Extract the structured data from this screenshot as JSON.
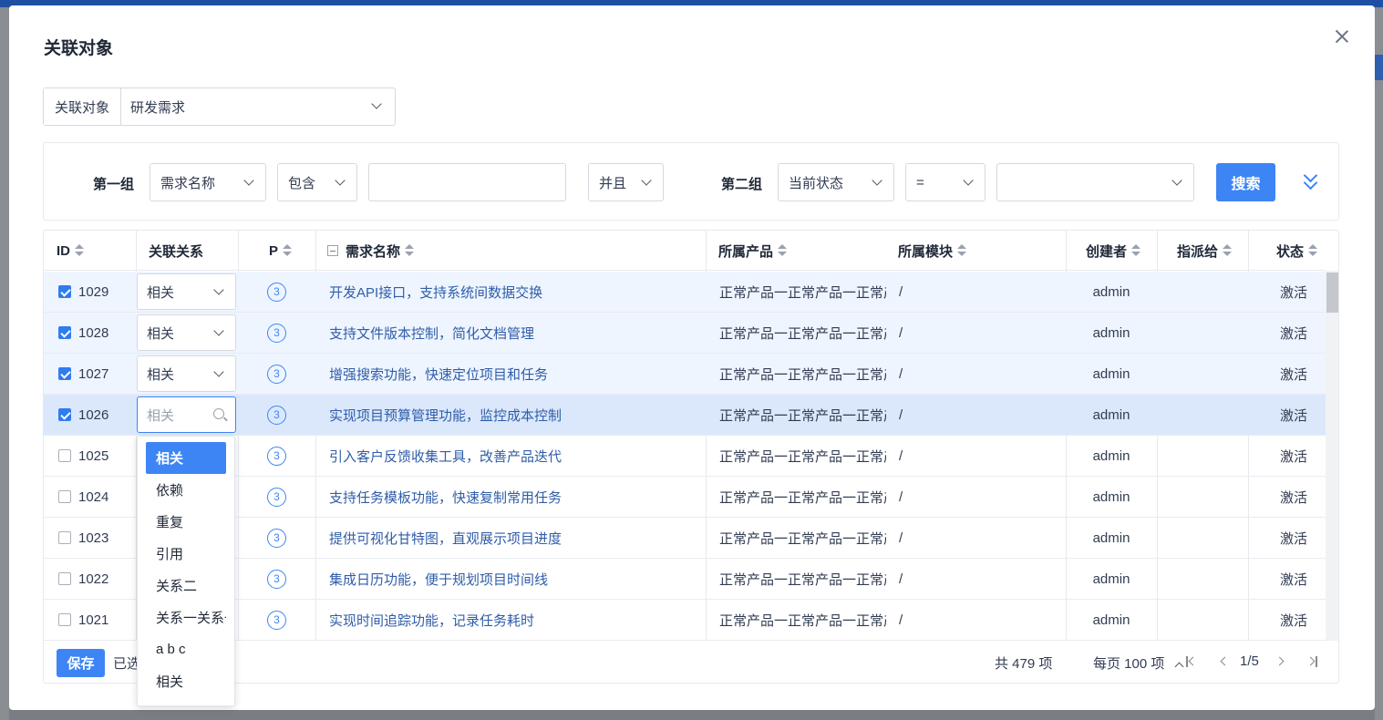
{
  "modal": {
    "title": "关联对象",
    "object_type_label": "关联对象",
    "object_type_value": "研发需求"
  },
  "search": {
    "group1_label": "第一组",
    "group1_field": "需求名称",
    "group1_operator": "包含",
    "group1_value": "",
    "logic": "并且",
    "group2_label": "第二组",
    "group2_field": "当前状态",
    "group2_operator": "=",
    "group2_value": "",
    "search_button": "搜索"
  },
  "table": {
    "headers": {
      "id": "ID",
      "relation": "关联关系",
      "priority": "P",
      "name": "需求名称",
      "product": "所属产品",
      "module": "所属模块",
      "creator": "创建者",
      "assignee": "指派给",
      "status": "状态"
    },
    "rows": [
      {
        "id": "1029",
        "checked": true,
        "relation": "相关",
        "priority": "3",
        "name": "开发API接口，支持系统间数据交换",
        "product": "正常产品一正常产品一正常产品",
        "module": "/",
        "creator": "admin",
        "assignee": "",
        "status": "激活"
      },
      {
        "id": "1028",
        "checked": true,
        "relation": "相关",
        "priority": "3",
        "name": "支持文件版本控制，简化文档管理",
        "product": "正常产品一正常产品一正常产品",
        "module": "/",
        "creator": "admin",
        "assignee": "",
        "status": "激活"
      },
      {
        "id": "1027",
        "checked": true,
        "relation": "相关",
        "priority": "3",
        "name": "增强搜索功能，快速定位项目和任务",
        "product": "正常产品一正常产品一正常产品",
        "module": "/",
        "creator": "admin",
        "assignee": "",
        "status": "激活"
      },
      {
        "id": "1026",
        "checked": true,
        "relation": "相关",
        "priority": "3",
        "name": "实现项目预算管理功能，监控成本控制",
        "product": "正常产品一正常产品一正常产品",
        "module": "/",
        "creator": "admin",
        "assignee": "",
        "status": "激活"
      },
      {
        "id": "1025",
        "checked": false,
        "relation": "",
        "priority": "3",
        "name": "引入客户反馈收集工具，改善产品迭代",
        "product": "正常产品一正常产品一正常产品",
        "module": "/",
        "creator": "admin",
        "assignee": "",
        "status": "激活"
      },
      {
        "id": "1024",
        "checked": false,
        "relation": "",
        "priority": "3",
        "name": "支持任务模板功能，快速复制常用任务",
        "product": "正常产品一正常产品一正常产品",
        "module": "/",
        "creator": "admin",
        "assignee": "",
        "status": "激活"
      },
      {
        "id": "1023",
        "checked": false,
        "relation": "",
        "priority": "3",
        "name": "提供可视化甘特图，直观展示项目进度",
        "product": "正常产品一正常产品一正常产品",
        "module": "/",
        "creator": "admin",
        "assignee": "",
        "status": "激活"
      },
      {
        "id": "1022",
        "checked": false,
        "relation": "",
        "priority": "3",
        "name": "集成日历功能，便于规划项目时间线",
        "product": "正常产品一正常产品一正常产品",
        "module": "/",
        "creator": "admin",
        "assignee": "",
        "status": "激活"
      },
      {
        "id": "1021",
        "checked": false,
        "relation": "",
        "priority": "3",
        "name": "实现时间追踪功能，记录任务耗时",
        "product": "正常产品一正常产品一正常产品",
        "module": "/",
        "creator": "admin",
        "assignee": "",
        "status": "激活"
      }
    ]
  },
  "footer": {
    "save_button": "保存",
    "selected_text": "已选",
    "total": "共 479 项",
    "per_page": "每页 100 项",
    "page": "1/5"
  },
  "relation_dropdown": {
    "placeholder": "相关",
    "options": [
      "相关",
      "依赖",
      "重复",
      "引用",
      "关系二",
      "关系一关系一",
      "a b c",
      "相关"
    ],
    "selected_index": 0
  },
  "colors": {
    "primary": "#3d85f4",
    "link": "#2f5da8",
    "checked_row": "#eef5ff",
    "active_row": "#dbe8fc"
  }
}
